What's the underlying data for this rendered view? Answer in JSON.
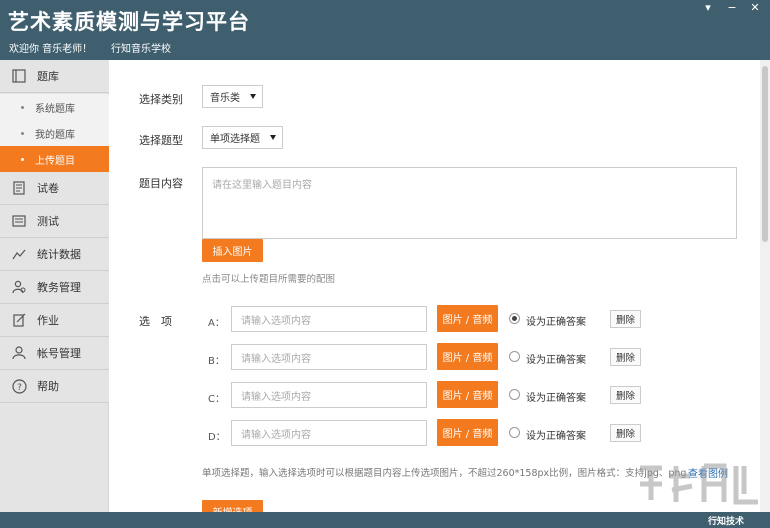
{
  "header": {
    "title": "艺术素质模测与学习平台",
    "welcome": "欢迎你 音乐老师！",
    "school": "行知音乐学校",
    "window_buttons": {
      "menu": "▾",
      "minimize": "−",
      "close": "✕"
    }
  },
  "sidebar": {
    "items": [
      {
        "label": "题库",
        "icon": "book-icon"
      },
      {
        "label": "试卷",
        "icon": "paper-icon"
      },
      {
        "label": "测试",
        "icon": "test-icon"
      },
      {
        "label": "统计数据",
        "icon": "chart-icon"
      },
      {
        "label": "教务管理",
        "icon": "users-icon"
      },
      {
        "label": "作业",
        "icon": "homework-icon"
      },
      {
        "label": "帐号管理",
        "icon": "user-icon"
      },
      {
        "label": "帮助",
        "icon": "help-icon"
      }
    ],
    "subitems": [
      {
        "label": "系统题库"
      },
      {
        "label": "我的题库"
      },
      {
        "label": "上传题目",
        "active": true
      }
    ]
  },
  "form": {
    "category_label": "选择类别",
    "category_value": "音乐类",
    "type_label": "选择题型",
    "type_value": "单项选择题",
    "content_label": "题目内容",
    "content_placeholder": "请在这里输入题目内容",
    "insert_image_button": "插入图片",
    "insert_image_hint": "点击可以上传题目所需要的配图",
    "options_label": "选　项",
    "option_placeholder": "请输入选项内容",
    "media_button": "图片 / 音频",
    "correct_label": "设为正确答案",
    "delete_button": "删除",
    "options": [
      {
        "letter": "A：",
        "checked": true
      },
      {
        "letter": "B：",
        "checked": false
      },
      {
        "letter": "C：",
        "checked": false
      },
      {
        "letter": "D：",
        "checked": false
      }
    ],
    "options_hint": "单项选择题，输入选择选项时可以根据题目内容上传选项图片，不超过260*158px比例，图片格式：支持jpg、png",
    "view_example_link": "查看图例",
    "add_option_button": "新增选项"
  },
  "brand": "行知技术",
  "colors": {
    "header": "#3f5f6f",
    "accent": "#f37a1f",
    "sidebar": "#e4e4e4",
    "link": "#2a6fb3"
  }
}
